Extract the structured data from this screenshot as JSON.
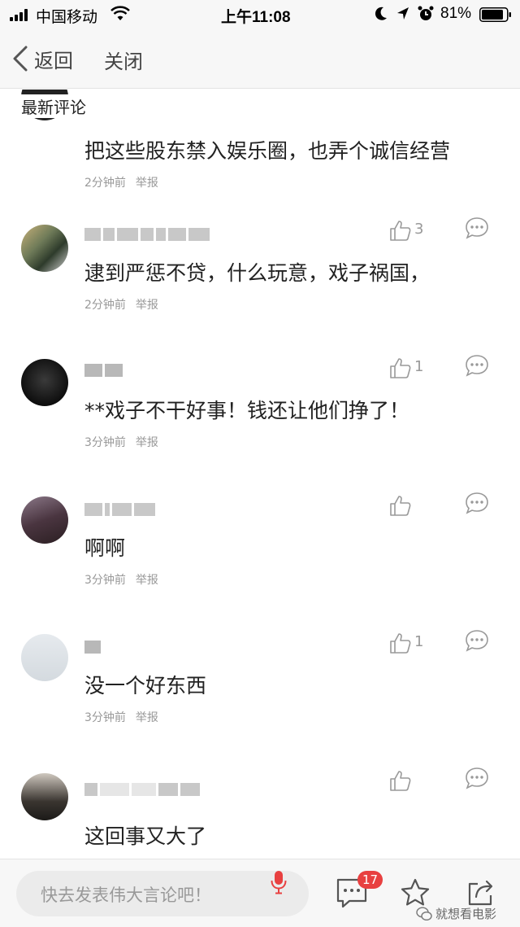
{
  "status_bar": {
    "carrier": "中国移动",
    "time": "上午11:08",
    "battery": "81%"
  },
  "nav": {
    "back_label": "返回",
    "close_label": "关闭"
  },
  "section_title": "最新评论",
  "comments": [
    {
      "text": "把这些股东禁入娱乐圈，也弄个诚信经营",
      "time": "2分钟前",
      "report": "举报",
      "likes": ""
    },
    {
      "text": "逮到严惩不贷，什么玩意，戏子祸国，",
      "time": "2分钟前",
      "report": "举报",
      "likes": "3"
    },
    {
      "text": "**戏子不干好事！钱还让他们挣了！",
      "time": "3分钟前",
      "report": "举报",
      "likes": "1"
    },
    {
      "text": "啊啊",
      "time": "3分钟前",
      "report": "举报",
      "likes": ""
    },
    {
      "text": "没一个好东西",
      "time": "3分钟前",
      "report": "举报",
      "likes": "1"
    },
    {
      "text": "这回事又大了",
      "time": "",
      "report": "",
      "likes": ""
    }
  ],
  "bottom_bar": {
    "input_placeholder": "快去发表伟大言论吧！",
    "comment_badge": "17",
    "watermark": "就想看电影"
  }
}
